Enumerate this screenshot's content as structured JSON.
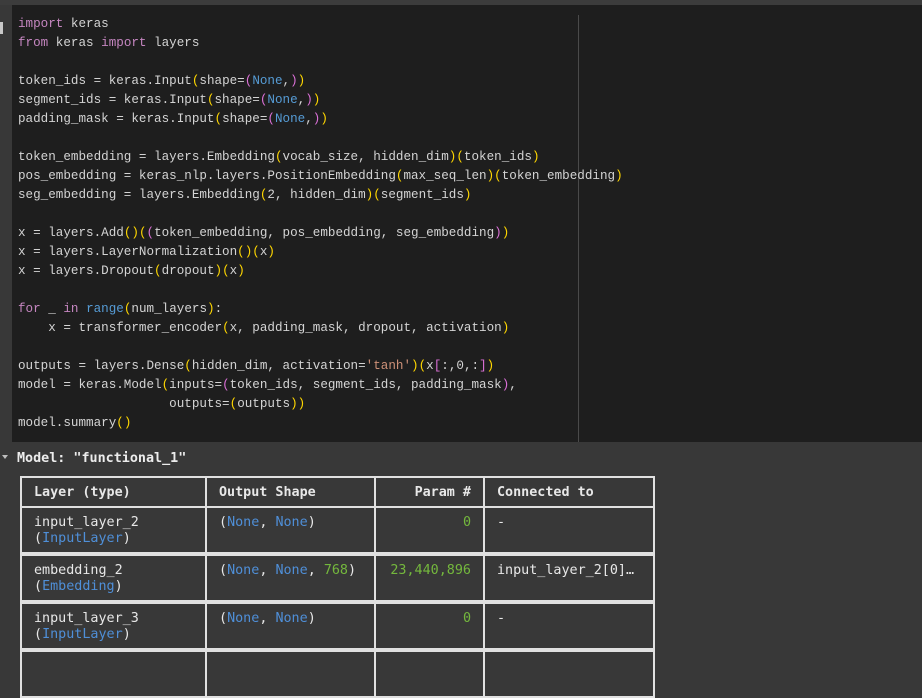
{
  "editor": {
    "code_lines": [
      "import keras",
      "from keras import layers",
      "",
      "token_ids = keras.Input(shape=(None,))",
      "segment_ids = keras.Input(shape=(None,))",
      "padding_mask = keras.Input(shape=(None,))",
      "",
      "token_embedding = layers.Embedding(vocab_size, hidden_dim)(token_ids)",
      "pos_embedding = keras_nlp.layers.PositionEmbedding(max_seq_len)(token_embedding)",
      "seg_embedding = layers.Embedding(2, hidden_dim)(segment_ids)",
      "",
      "x = layers.Add()((token_embedding, pos_embedding, seg_embedding))",
      "x = layers.LayerNormalization()(x)",
      "x = layers.Dropout(dropout)(x)",
      "",
      "for _ in range(num_layers):",
      "    x = transformer_encoder(x, padding_mask, dropout, activation)",
      "",
      "outputs = layers.Dense(hidden_dim, activation='tanh')(x[:,0,:])",
      "model = keras.Model(inputs=(token_ids, segment_ids, padding_mask),",
      "                    outputs=(outputs))",
      "model.summary()"
    ]
  },
  "output": {
    "model_title": "Model: \"functional_1\"",
    "table": {
      "headers": [
        "Layer (type)",
        "Output Shape",
        "Param #",
        "Connected to"
      ],
      "rows": [
        {
          "layer_name": "input_layer_2",
          "layer_type": "InputLayer",
          "shape": [
            "None",
            "None"
          ],
          "params": "0",
          "connected_to": "-"
        },
        {
          "layer_name": "embedding_2",
          "layer_type": "Embedding",
          "shape": [
            "None",
            "None",
            "768"
          ],
          "params": "23,440,896",
          "connected_to": "input_layer_2[0]…"
        },
        {
          "layer_name": "input_layer_3",
          "layer_type": "InputLayer",
          "shape": [
            "None",
            "None"
          ],
          "params": "0",
          "connected_to": "-"
        }
      ]
    }
  },
  "colors": {
    "editor_bg": "#1e1e1e",
    "output_bg": "#383838",
    "keyword": "#c586c0",
    "none_literal": "#569cd6",
    "string": "#ce9178",
    "numeric": "#74b83d",
    "type_name": "#4f8fd8"
  }
}
